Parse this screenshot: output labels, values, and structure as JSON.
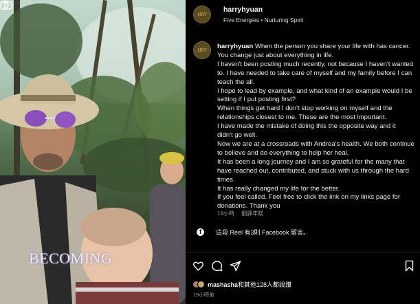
{
  "media": {
    "overlay_caption": "BECOMING"
  },
  "header": {
    "avatar_text": "HRV",
    "username": "harryhyuan",
    "subline": "Five Energies • Nurturing Spirit"
  },
  "post": {
    "avatar_text": "HRV",
    "username": "harryhyuan",
    "lines": [
      " When the person you share your life with has cancer.",
      "You change just about everything in life.",
      "I haven't been posting much recently, not because I haven't wanted",
      "to. I have needed to take care of myself and my family before I can",
      "teach the all.",
      "I hope to lead by example, and what kind of an example would I be",
      "setting if I put posting first?",
      "When things get hard I don't stop working on myself and the",
      "relationships closest to me. These are the most important.",
      "I have made the mistake of doing this the opposite way and it",
      "didn't go well.",
      "Now we are at a crossroads with Andrea's health. We both continue",
      "to believe and do everything to help her heal.",
      "It has been a long journey and I am so grateful for the many that",
      "have reached out, contributed, and stuck with us through the hard",
      "times.",
      "It has really changed my life for the better.",
      "If you feel called. Feel free to click the link on my links page for",
      "donations. Thank you"
    ],
    "time": "19小時",
    "see_translation": "翻譯年糕"
  },
  "facebook": {
    "text": "這段 Reel 有3則 Facebook 留言。"
  },
  "likes": {
    "user": "mashasha",
    "rest": "和其他128人都說讚"
  },
  "posted_ago": "19小時前",
  "icons": [
    "camera-icon",
    "heart-icon",
    "comment-icon",
    "share-icon",
    "bookmark-icon",
    "facebook-icon"
  ]
}
